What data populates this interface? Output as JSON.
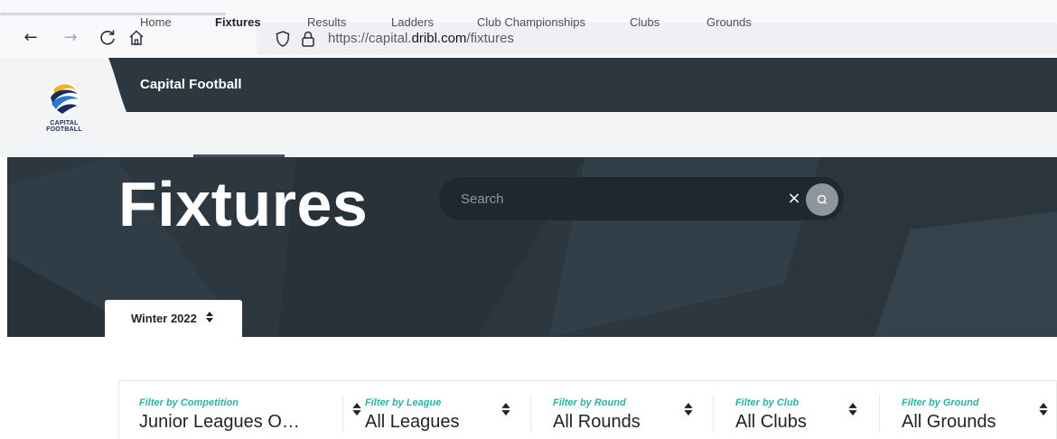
{
  "browser": {
    "url_prefix": "https://capital.",
    "url_domain": "dribl.com",
    "url_path": "/fixtures"
  },
  "header": {
    "logo_text_line1": "CAPITAL",
    "logo_text_line2": "FOOTBALL",
    "brand_title": "Capital Football"
  },
  "menu": {
    "items": [
      {
        "label": "Home",
        "active": false
      },
      {
        "label": "Fixtures",
        "active": true
      },
      {
        "label": "Results",
        "active": false
      },
      {
        "label": "Ladders",
        "active": false
      },
      {
        "label": "Club Championships",
        "active": false
      },
      {
        "label": "Clubs",
        "active": false
      },
      {
        "label": "Grounds",
        "active": false
      }
    ]
  },
  "hero": {
    "title": "Fixtures",
    "search_placeholder": "Search",
    "search_value": "",
    "clear_glyph": "×"
  },
  "season": {
    "label": "Winter 2022",
    "arrow": "▲▼"
  },
  "filters": [
    {
      "label": "Filter by Competition",
      "value": "Junior Leagues O…"
    },
    {
      "label": "Filter by League",
      "value": "All Leagues"
    },
    {
      "label": "Filter by Round",
      "value": "All Rounds"
    },
    {
      "label": "Filter by Club",
      "value": "All Clubs"
    },
    {
      "label": "Filter by Ground",
      "value": "All Grounds"
    }
  ],
  "colors": {
    "header_dark": "#2c3740",
    "accent_teal": "#2bb0a8",
    "logo_blue": "#1a2d5e",
    "logo_gold": "#f0b323"
  },
  "icons": {
    "back": "arrow-left-icon",
    "forward": "arrow-right-icon",
    "reload": "reload-icon",
    "home": "home-icon",
    "shield": "shield-icon",
    "lock": "lock-icon",
    "search": "search-icon",
    "sort": "sort-arrows-icon"
  }
}
